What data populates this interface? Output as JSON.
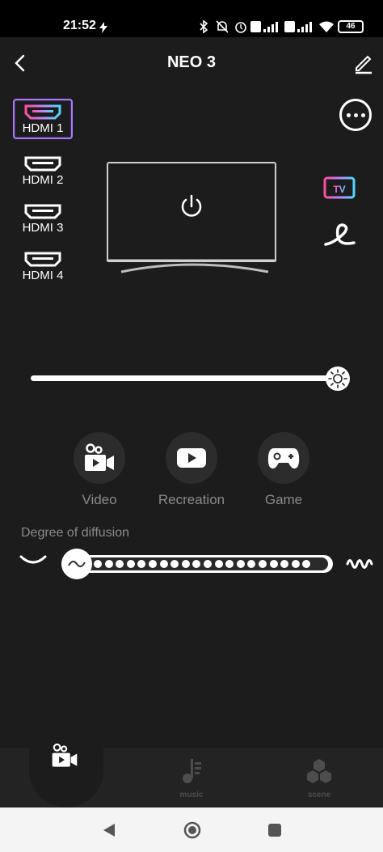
{
  "status": {
    "time": "21:52",
    "battery": "46"
  },
  "header": {
    "title": "NEO 3"
  },
  "inputs": [
    {
      "label": "HDMI 1",
      "selected": true
    },
    {
      "label": "HDMI 2",
      "selected": false
    },
    {
      "label": "HDMI 3",
      "selected": false
    },
    {
      "label": "HDMI 4",
      "selected": false
    }
  ],
  "tv_modes": [
    {
      "label": "TV"
    }
  ],
  "brightness": {
    "level": 1.0
  },
  "modes": [
    {
      "label": "Video"
    },
    {
      "label": "Recreation"
    },
    {
      "label": "Game"
    }
  ],
  "diffusion": {
    "label": "Degree of diffusion",
    "level": 0.0
  },
  "bottom_nav": [
    {
      "label": "",
      "icon": "video-mode-icon",
      "active": true
    },
    {
      "label": "music",
      "icon": "music-note-icon",
      "active": false
    },
    {
      "label": "scene",
      "icon": "scene-hexagon-icon",
      "active": false
    }
  ],
  "colors": {
    "background": "#1c1c1c",
    "accent": "#a879ff",
    "nav_bar": "#232323"
  }
}
